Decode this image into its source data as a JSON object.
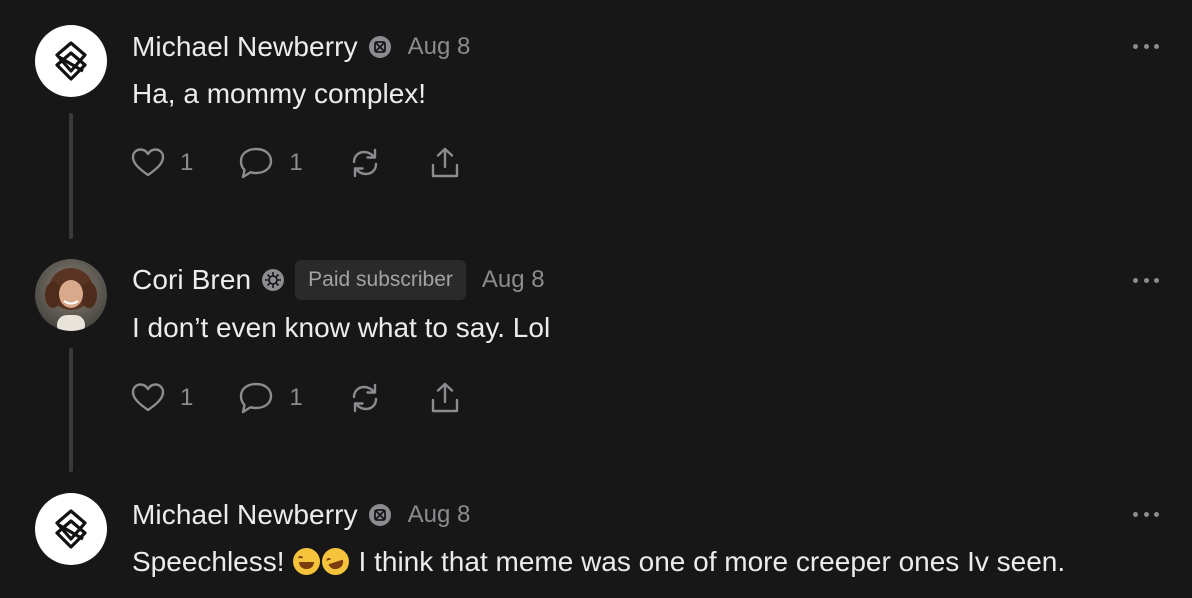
{
  "comments": [
    {
      "author": "Michael Newberry",
      "date": "Aug 8",
      "subscriber_label": "",
      "text": "Ha, a mommy complex!",
      "likes": "1",
      "replies": "1"
    },
    {
      "author": "Cori Bren",
      "date": "Aug 8",
      "subscriber_label": "Paid subscriber",
      "text": "I don’t even know what to say. Lol",
      "likes": "1",
      "replies": "1"
    },
    {
      "author": "Michael Newberry",
      "date": "Aug 8",
      "subscriber_label": "",
      "text_before_emoji": "Speechless!",
      "emojis": [
        "face-with-tears-of-joy",
        "rolling-on-the-floor-laughing"
      ],
      "text_after_emoji": "I think that meme was one of more creeper ones Iv seen."
    }
  ],
  "icons": {
    "like": "heart-icon",
    "reply": "speech-bubble-icon",
    "restack": "restack-arrows-icon",
    "share": "share-upload-icon",
    "menu": "more-dots-icon",
    "badge": "subscriber-badge-icon"
  },
  "colors": {
    "background": "#171718",
    "text": "#ececec",
    "muted": "#8c8c90",
    "pill_background": "#2a2a2b"
  }
}
